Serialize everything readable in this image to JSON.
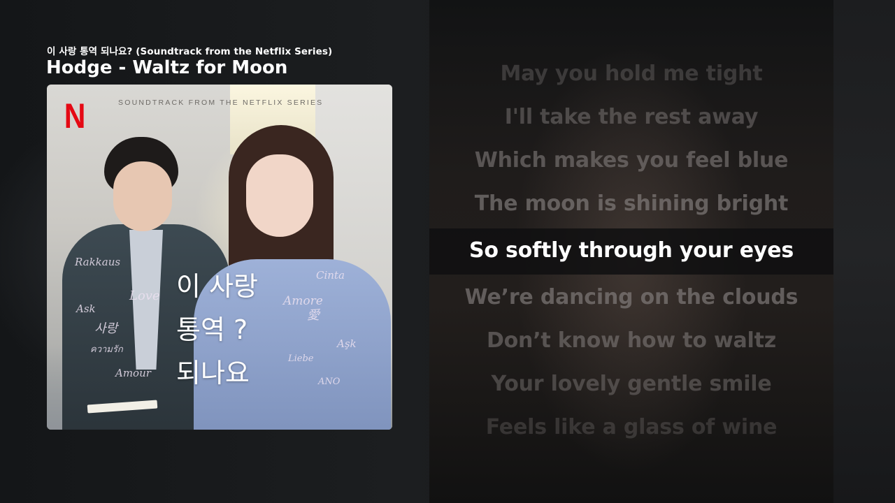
{
  "header": {
    "album": "이 사랑 통역 되나요? (Soundtrack from the Netflix Series)",
    "track": "Hodge - Waltz for Moon"
  },
  "album_art": {
    "brand_logo": "N",
    "caption": "SOUNDTRACK FROM THE NETFLIX SERIES",
    "title_lines": [
      "이 사랑",
      "통역 ?",
      "되나요"
    ],
    "scribbles": [
      "Rakkaus",
      "Love",
      "Ask",
      "사랑",
      "ความรัก",
      "Amour",
      "Cinta",
      "Amore",
      "愛",
      "Aşk",
      "Liebe",
      "ANO"
    ]
  },
  "lyrics": {
    "lines": [
      "May you hold me tight",
      "I'll take the rest away",
      "Which makes you feel blue",
      "The moon is shining bright",
      "So softly through your eyes",
      "We’re dancing on the clouds",
      "Don’t know how to waltz",
      "Your lovely gentle smile",
      "Feels like a glass of wine"
    ],
    "active_index": 4
  },
  "colors": {
    "active_lyric": "#ffffff",
    "inactive_lyric": "#8a8584",
    "netflix_red": "#e50914"
  }
}
